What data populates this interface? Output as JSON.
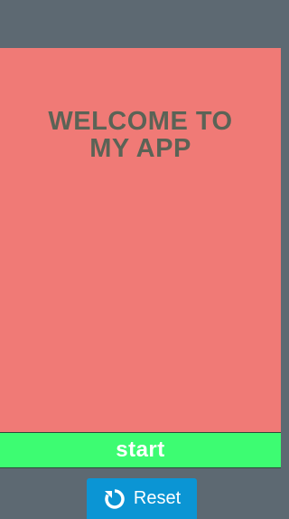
{
  "welcome": {
    "title": "WELCOME TO\nMY APP"
  },
  "start": {
    "label": "start"
  },
  "reset": {
    "label": "Reset",
    "icon": "refresh-icon"
  },
  "colors": {
    "screen_background": "#f07a76",
    "frame_background": "#5d6972",
    "title_text": "#5b6356",
    "start_button": "#3dfc72",
    "reset_button": "#0b95d4"
  }
}
